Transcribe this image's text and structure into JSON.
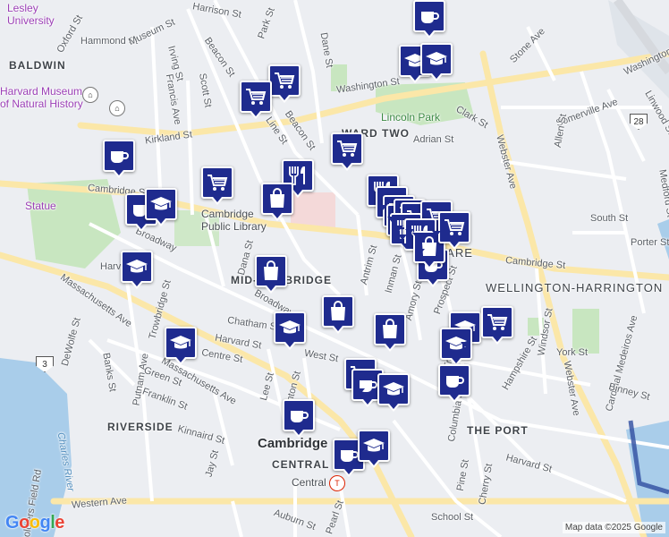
{
  "map": {
    "provider_logo": "Google",
    "attribution": "Map data ©2025 Google",
    "colors": {
      "pin": "#1f2b8e",
      "park": "#c8e6c0",
      "water": "#a9cdea",
      "road": "#ffffff",
      "arterial": "#fbe7a8"
    },
    "labels": {
      "lesley": "Lesley\nUniversity",
      "baldwin": "BALDWIN",
      "harvard_museum": "Harvard Museum\nof Natural History",
      "ward_two": "WARD TWO",
      "lincoln_park": "Lincoln Park",
      "cambridge_library": "Cambridge\nPublic Library",
      "mid_cambridge": "MID-CAMBRIDGE",
      "statue": "Statue",
      "inman_square": "SQUARE",
      "wellington": "WELLINGTON-HARRINGTON",
      "riverside": "RIVERSIDE",
      "the_port": "THE PORT",
      "cambridge": "Cambridge",
      "central": "CENTRAL",
      "central_station": "Central",
      "charles_river": "Charles River",
      "soldiers_field": "Soldiers Field Rd"
    },
    "streets": {
      "harrison": "Harrison St",
      "park": "Park St",
      "hammond": "Hammond St",
      "museum": "Museum St",
      "oxford": "Oxford St",
      "dane": "Dane St",
      "beacon1": "Beacon St",
      "beacon2": "Beacon St",
      "irving": "Irving St",
      "scott": "Scott St",
      "francis": "Francis Ave",
      "washington": "Washington St",
      "washington2": "Washington St",
      "stone": "Stone Ave",
      "clark": "Clark St",
      "adrian": "Adrian St",
      "somerville": "Somerville Ave",
      "kirkland": "Kirkland St",
      "line": "Line St",
      "webster": "Webster Ave",
      "allen": "Allen St",
      "linwood": "Linwood St",
      "cambridge1": "Cambridge St",
      "cambridge2": "Cambridge St",
      "broadway1": "Broadway",
      "broadway2": "Broadway",
      "dana": "Dana St",
      "harvard1": "Harvard St",
      "harvard2": "Harvard St",
      "chatham": "Chatham St",
      "antrim": "Antrim St",
      "inman": "Inman St",
      "amory": "Amory St",
      "prospect": "Prospect St",
      "tremont": "Tremont St",
      "hampshire": "Hampshire St",
      "windsor": "Windsor St",
      "york": "York St",
      "cardinal": "Cardinal Medeiros Ave",
      "binney": "Binney St",
      "medford": "Medford St",
      "south": "South St",
      "porter": "Porter St",
      "mass1": "Massachusetts Ave",
      "mass2": "Massachusetts Ave",
      "trowbridge": "Trowbridge St",
      "centre": "Centre St",
      "west": "West St",
      "lee": "Lee St",
      "clinton": "Clinton St",
      "dewolfe": "DeWolfe St",
      "banks": "Banks St",
      "putnam": "Putnam Ave",
      "green": "Green St",
      "franklin": "Franklin St",
      "kinnaird": "Kinnaird St",
      "jay": "Jay St",
      "western": "Western Ave",
      "auburn": "Auburn St",
      "pearl": "Pearl St",
      "columbia": "Columbia St",
      "pine": "Pine St",
      "cherry": "Cherry St",
      "school": "School St",
      "harvard3": "Harvard St"
    },
    "route_shields": [
      "3",
      "28"
    ],
    "markers": [
      {
        "type": "coffee",
        "label": "Coffee shop"
      },
      {
        "type": "school",
        "label": "School"
      },
      {
        "type": "school",
        "label": "School"
      },
      {
        "type": "cart",
        "label": "Grocery store"
      },
      {
        "type": "cart",
        "label": "Grocery store"
      },
      {
        "type": "cart",
        "label": "Grocery store"
      },
      {
        "type": "restaurant",
        "label": "Restaurant"
      },
      {
        "type": "coffee",
        "label": "Coffee shop"
      },
      {
        "type": "cart",
        "label": "Grocery store"
      },
      {
        "type": "shopping-bag",
        "label": "Shop"
      },
      {
        "type": "coffee",
        "label": "Coffee shop"
      },
      {
        "type": "school",
        "label": "School"
      },
      {
        "type": "school",
        "label": "School"
      },
      {
        "type": "shopping-bag",
        "label": "Shop"
      },
      {
        "type": "school",
        "label": "School"
      },
      {
        "type": "shopping-bag",
        "label": "Shop"
      },
      {
        "type": "school",
        "label": "School"
      },
      {
        "type": "shopping-bag",
        "label": "Shop"
      },
      {
        "type": "restaurant",
        "label": "Restaurant"
      },
      {
        "type": "coffee",
        "label": "Coffee shop"
      },
      {
        "type": "cart",
        "label": "Grocery store"
      },
      {
        "type": "restaurant",
        "label": "Restaurant"
      },
      {
        "type": "cart",
        "label": "Grocery store"
      },
      {
        "type": "cart",
        "label": "Grocery store"
      },
      {
        "type": "cart",
        "label": "Grocery store"
      },
      {
        "type": "restaurant",
        "label": "Restaurant"
      },
      {
        "type": "restaurant",
        "label": "Restaurant"
      },
      {
        "type": "coffee",
        "label": "Coffee shop"
      },
      {
        "type": "shopping-bag",
        "label": "Shop"
      },
      {
        "type": "cart",
        "label": "Grocery store"
      },
      {
        "type": "school",
        "label": "School"
      },
      {
        "type": "cart",
        "label": "Grocery store"
      },
      {
        "type": "school",
        "label": "School"
      },
      {
        "type": "coffee",
        "label": "Coffee shop"
      },
      {
        "type": "cart",
        "label": "Grocery store"
      },
      {
        "type": "coffee",
        "label": "Coffee shop"
      },
      {
        "type": "school",
        "label": "School"
      },
      {
        "type": "coffee",
        "label": "Coffee shop"
      },
      {
        "type": "coffee",
        "label": "Coffee shop"
      },
      {
        "type": "school",
        "label": "School"
      }
    ]
  }
}
